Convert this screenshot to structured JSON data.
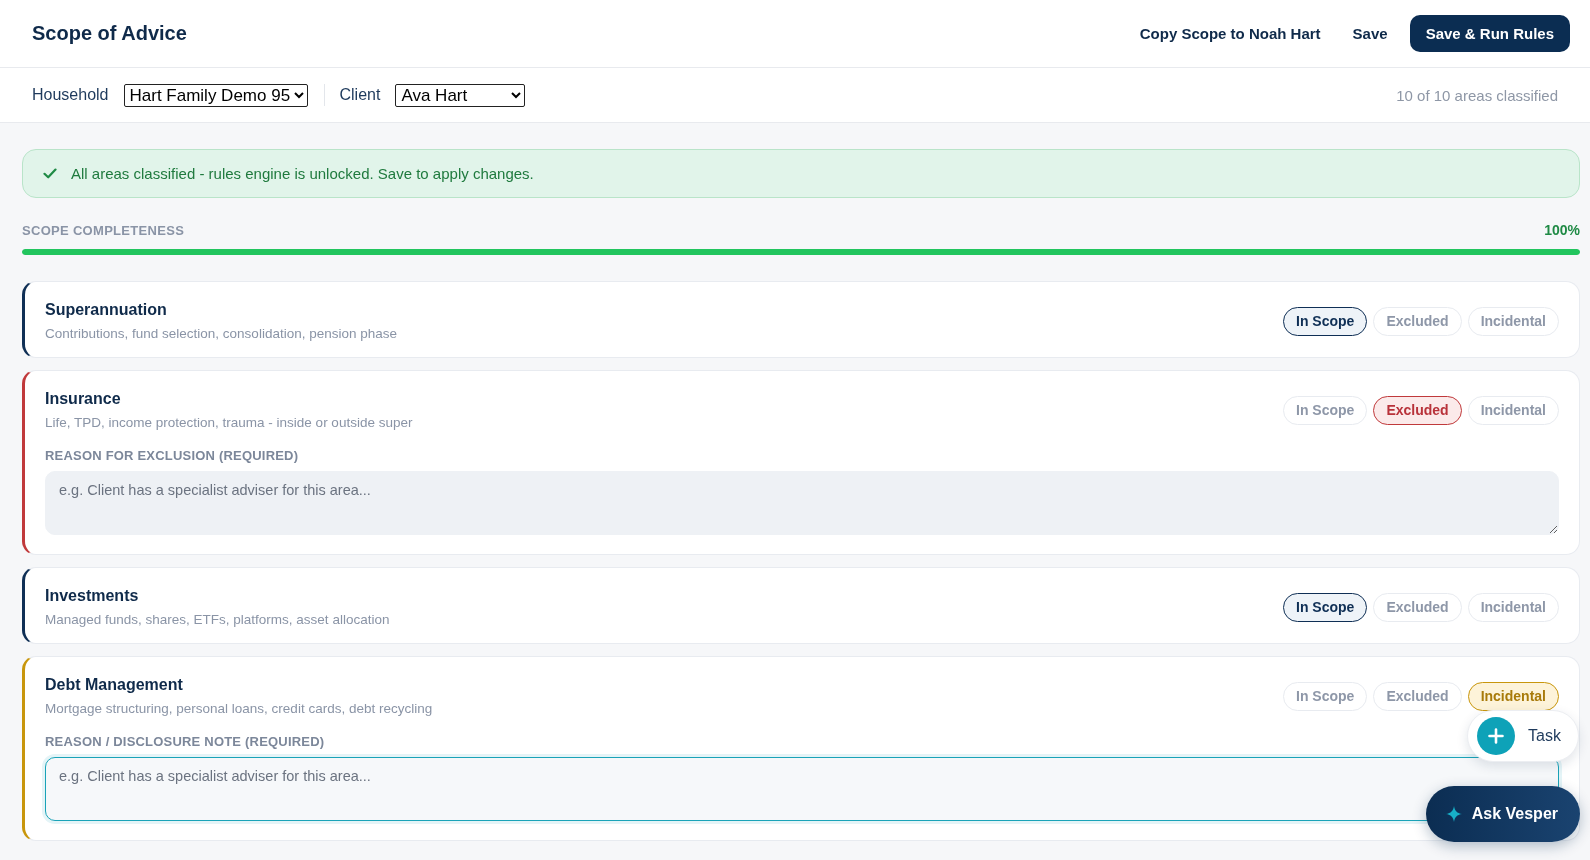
{
  "header": {
    "title": "Scope of Advice",
    "actions": [
      {
        "label": "Copy Scope to Noah Hart",
        "kind": "link"
      },
      {
        "label": "Save",
        "kind": "link"
      },
      {
        "label": "Save & Run Rules",
        "kind": "primary"
      }
    ]
  },
  "filters": {
    "household": {
      "label": "Household",
      "value": "Hart Family Demo 95"
    },
    "client": {
      "label": "Client",
      "value": "Ava Hart"
    },
    "summary": "10 of 10 areas classified"
  },
  "banner": {
    "text": "All areas classified - rules engine is unlocked. Save to apply changes."
  },
  "completeness": {
    "label": "SCOPE COMPLETENESS",
    "reading": "100%",
    "level": 1
  },
  "areas": [
    {
      "title": "Superannuation",
      "description": "Contributions, fund selection, consolidation, pension phase",
      "options": [
        {
          "label": "In Scope",
          "kind": "in_scope",
          "selected": true
        },
        {
          "label": "Excluded",
          "kind": "excluded",
          "selected": false
        },
        {
          "label": "Incidental",
          "kind": "incidental",
          "selected": false
        }
      ]
    },
    {
      "title": "Insurance",
      "description": "Life, TPD, income protection, trauma - inside or outside super",
      "options": [
        {
          "label": "In Scope",
          "kind": "in_scope",
          "selected": false
        },
        {
          "label": "Excluded",
          "kind": "excluded",
          "selected": true
        },
        {
          "label": "Incidental",
          "kind": "incidental",
          "selected": false
        }
      ],
      "note": {
        "label": "REASON FOR EXCLUSION (REQUIRED)",
        "placeholder": "e.g. Client has a specialist adviser for this area...",
        "focused": false
      }
    },
    {
      "title": "Investments",
      "description": "Managed funds, shares, ETFs, platforms, asset allocation",
      "options": [
        {
          "label": "In Scope",
          "kind": "in_scope",
          "selected": true
        },
        {
          "label": "Excluded",
          "kind": "excluded",
          "selected": false
        },
        {
          "label": "Incidental",
          "kind": "incidental",
          "selected": false
        }
      ]
    },
    {
      "title": "Debt Management",
      "description": "Mortgage structuring, personal loans, credit cards, debt recycling",
      "options": [
        {
          "label": "In Scope",
          "kind": "in_scope",
          "selected": false
        },
        {
          "label": "Excluded",
          "kind": "excluded",
          "selected": false
        },
        {
          "label": "Incidental",
          "kind": "incidental",
          "selected": true
        }
      ],
      "note": {
        "label": "REASON / DISCLOSURE NOTE (REQUIRED)",
        "placeholder": "e.g. Client has a specialist adviser for this area...",
        "focused": true
      }
    }
  ],
  "floating": {
    "task": {
      "label": "Task"
    },
    "assistant": {
      "label": "Ask Vesper"
    }
  }
}
